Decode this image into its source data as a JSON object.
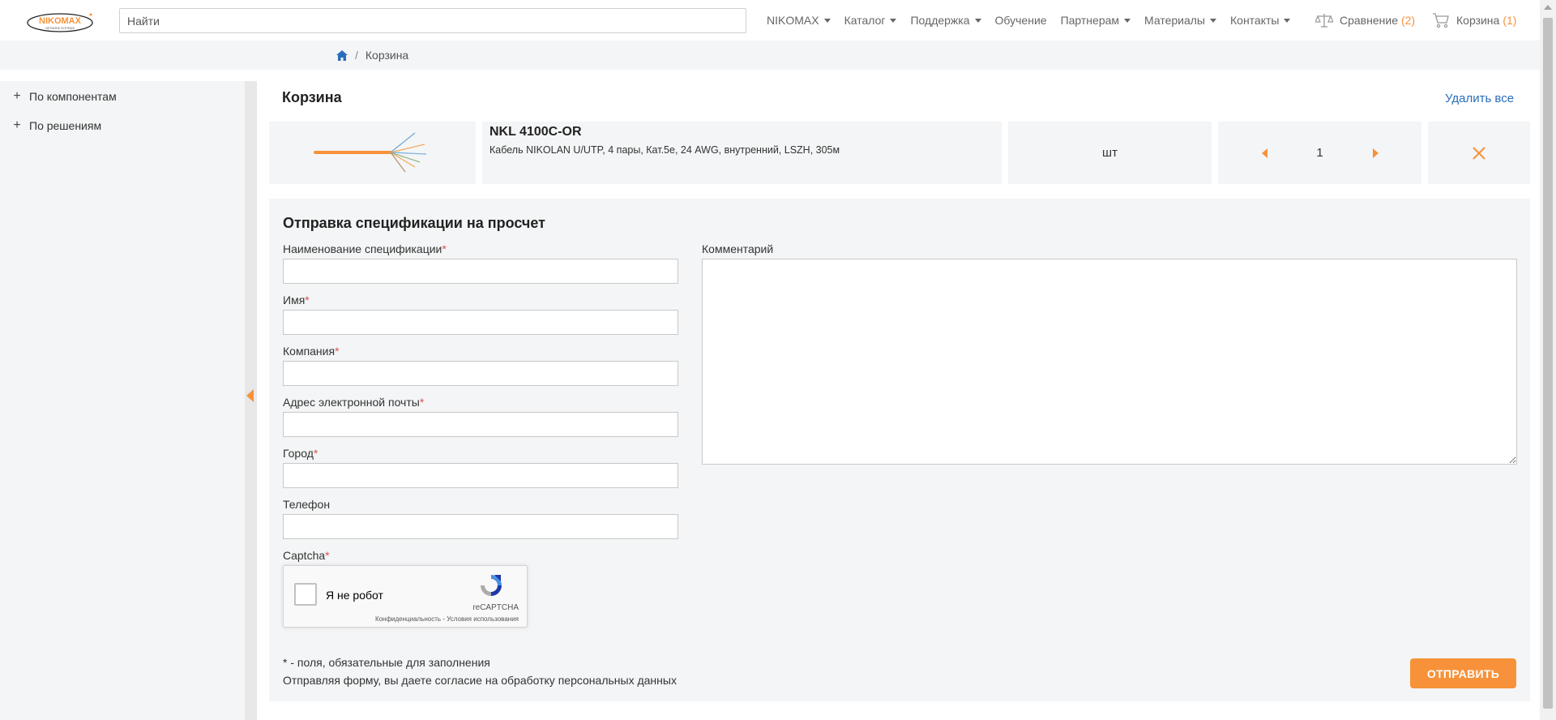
{
  "header": {
    "search_placeholder": "Найти",
    "nav": [
      {
        "label": "NIKOMAX",
        "dropdown": true
      },
      {
        "label": "Каталог",
        "dropdown": true
      },
      {
        "label": "Поддержка",
        "dropdown": true
      },
      {
        "label": "Обучение",
        "dropdown": false
      },
      {
        "label": "Партнерам",
        "dropdown": true
      },
      {
        "label": "Материалы",
        "dropdown": true
      },
      {
        "label": "Контакты",
        "dropdown": true
      }
    ],
    "compare": {
      "label": "Сравнение",
      "count": "(2)"
    },
    "cart": {
      "label": "Корзина",
      "count": "(1)"
    },
    "accent_color": "#f7923a"
  },
  "breadcrumb": {
    "current": "Корзина"
  },
  "sidebar": {
    "items": [
      {
        "label": "По компонентам"
      },
      {
        "label": "По решениям"
      }
    ]
  },
  "cart": {
    "title": "Корзина",
    "delete_all": "Удалить все",
    "item": {
      "code": "NKL 4100C-OR",
      "description": "Кабель NIKOLAN U/UTP, 4 пары, Кат.5е, 24 AWG, внутренний, LSZH, 305м",
      "unit": "шт",
      "quantity": "1"
    }
  },
  "form": {
    "title": "Отправка спецификации на просчет",
    "fields": [
      {
        "label": "Наименование спецификации",
        "required": "*"
      },
      {
        "label": "Имя",
        "required": "*"
      },
      {
        "label": "Компания",
        "required": "*"
      },
      {
        "label": "Адрес электронной почты",
        "required": "*"
      },
      {
        "label": "Город",
        "required": "*"
      },
      {
        "label": "Телефон",
        "required": ""
      }
    ],
    "captcha_label": "Captcha",
    "captcha_required": "*",
    "comment_label": "Комментарий",
    "recaptcha": {
      "checkbox_label": "Я не робот",
      "brand": "reCAPTCHA",
      "terms": "Конфиденциальность - Условия использования"
    },
    "note_required": "* - поля, обязательные для заполнения",
    "note_consent": "Отправляя форму, вы даете согласие на обработку персональных данных",
    "submit_label": "ОТПРАВИТЬ"
  }
}
